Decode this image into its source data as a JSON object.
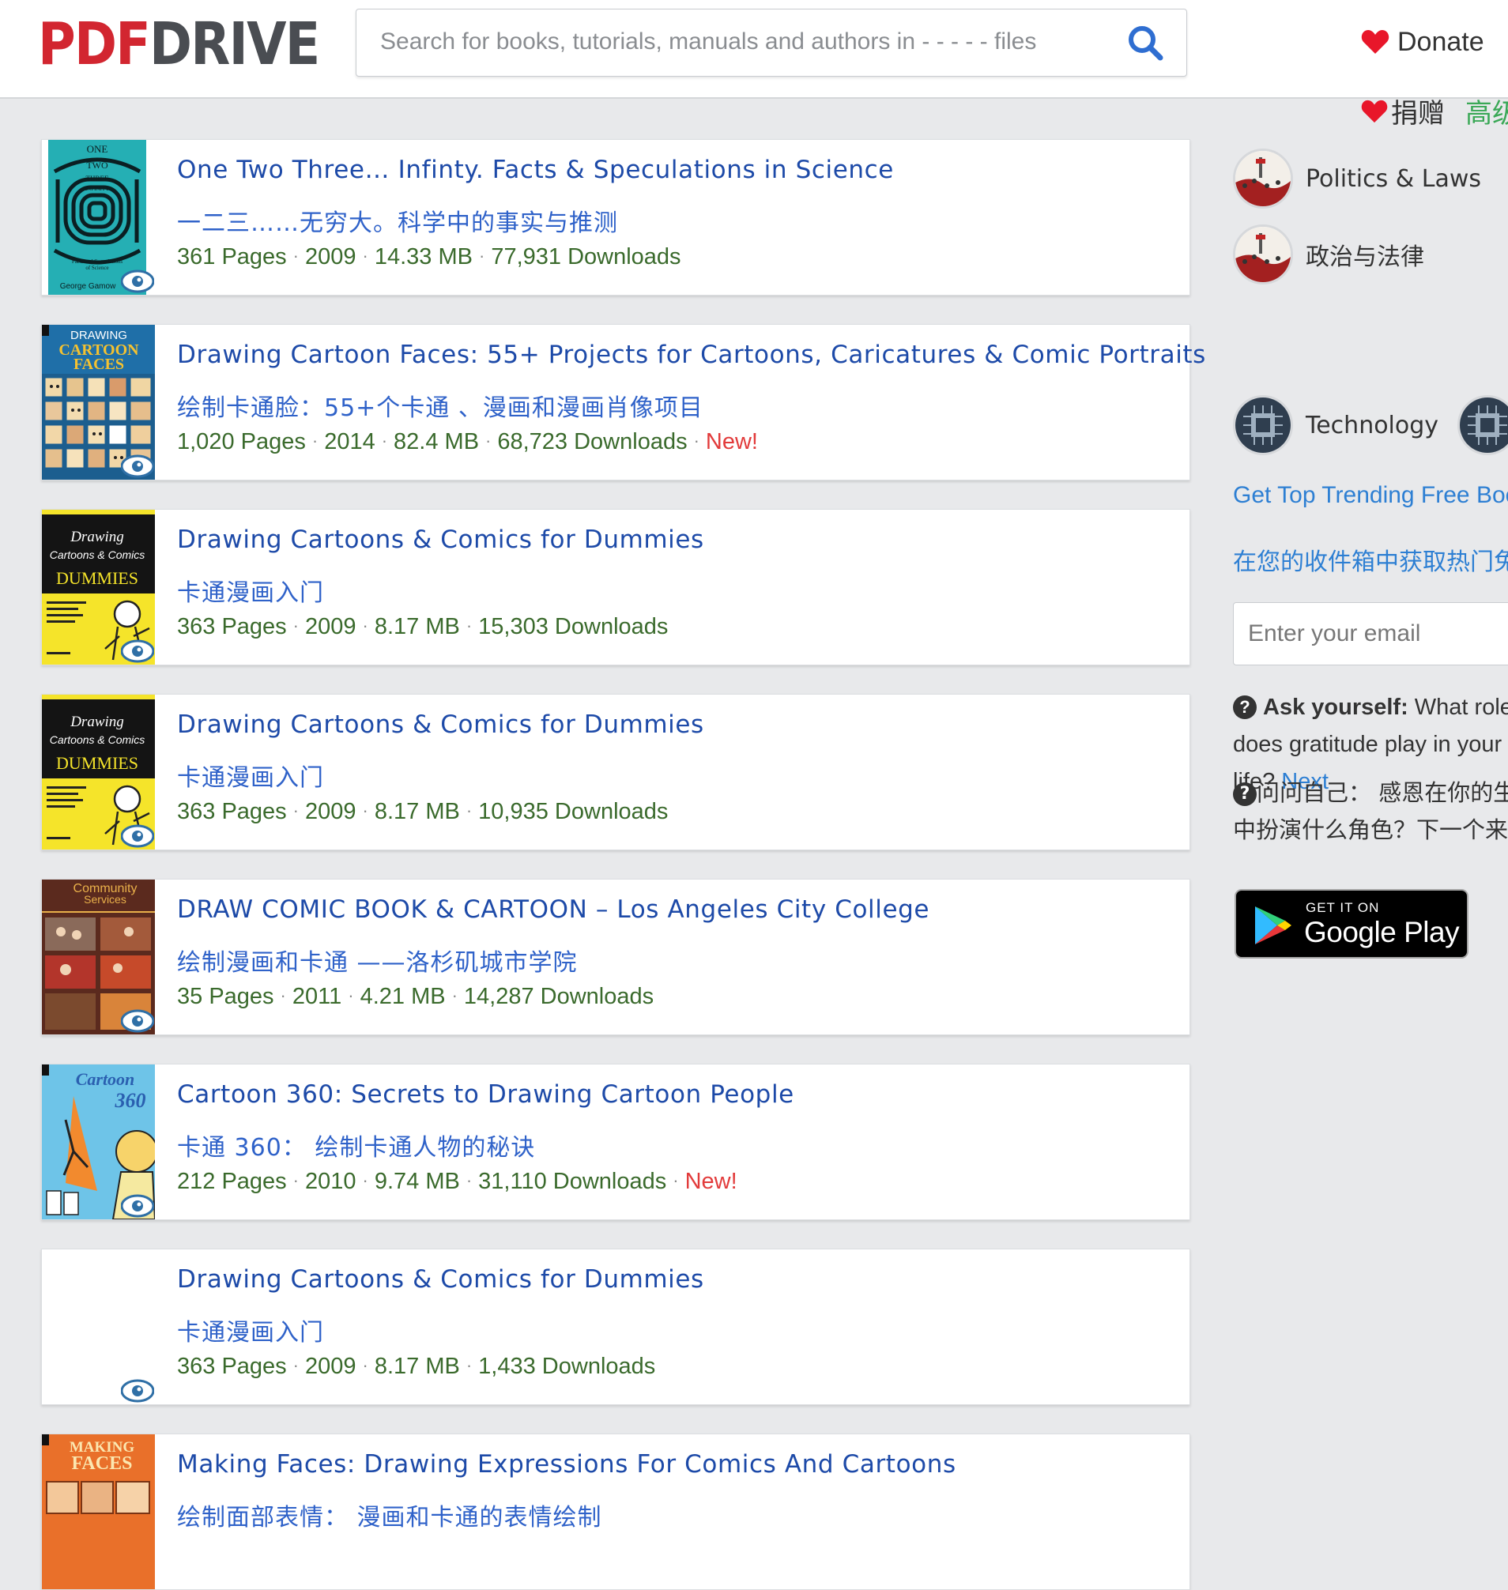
{
  "header": {
    "logo_pdf": "PDF",
    "logo_drive": "DRIVE",
    "search_placeholder": "Search for books, tutorials, manuals and authors in - - - - - files",
    "donate_label": "Donate",
    "donate_cn_label": "捐赠",
    "donate_cn_green": "高级"
  },
  "books": [
    {
      "title": "One Two Three… Infinty. Facts & Speculations in Science",
      "title_cn": "一二三……无穷大。科学中的事实与推测",
      "pages": "361 Pages",
      "year": "2009",
      "size": "14.33 MB",
      "downloads": "77,931 Downloads",
      "new": ""
    },
    {
      "title": "Drawing Cartoon Faces: 55+ Projects for Cartoons, Caricatures & Comic Portraits",
      "title_cn": "绘制卡通脸：55+个卡通 、漫画和漫画肖像项目",
      "pages": "1,020 Pages",
      "year": "2014",
      "size": "82.4 MB",
      "downloads": "68,723 Downloads",
      "new": "New!"
    },
    {
      "title": "Drawing Cartoons & Comics for Dummies",
      "title_cn": "卡通漫画入门",
      "pages": "363 Pages",
      "year": "2009",
      "size": "8.17 MB",
      "downloads": "15,303 Downloads",
      "new": ""
    },
    {
      "title": "Drawing Cartoons & Comics for Dummies",
      "title_cn": "卡通漫画入门",
      "pages": "363 Pages",
      "year": "2009",
      "size": "8.17 MB",
      "downloads": "10,935 Downloads",
      "new": ""
    },
    {
      "title": "DRAW COMIC BOOK & CARTOON – Los Angeles City College",
      "title_cn": "绘制漫画和卡通 ——洛杉矶城市学院",
      "pages": "35 Pages",
      "year": "2011",
      "size": "4.21 MB",
      "downloads": "14,287 Downloads",
      "new": ""
    },
    {
      "title": "Cartoon 360: Secrets to Drawing Cartoon People",
      "title_cn": "卡通 360：  绘制卡通人物的秘诀",
      "pages": "212 Pages",
      "year": "2010",
      "size": "9.74 MB",
      "downloads": "31,110 Downloads",
      "new": "New!"
    },
    {
      "title": "Drawing Cartoons & Comics for Dummies",
      "title_cn": "卡通漫画入门",
      "pages": "363 Pages",
      "year": "2009",
      "size": "8.17 MB",
      "downloads": "1,433 Downloads",
      "new": ""
    },
    {
      "title": "Making Faces: Drawing Expressions For Comics And Cartoons",
      "title_cn": "绘制面部表情：  漫画和卡通的表情绘制",
      "pages": "",
      "year": "",
      "size": "",
      "downloads": "",
      "new": ""
    }
  ],
  "covers": {
    "one_two_three": [
      "ONE",
      "TWO",
      "THREE",
      "INFINITY",
      "Facts and Speculations",
      "of Science",
      "George Gamow"
    ],
    "drawing_cartoon_faces": [
      "DRAWING",
      "CARTOON",
      "FACES"
    ],
    "dummies": [
      "Drawing",
      "Cartoons & Comics",
      "DUMMIES"
    ],
    "community": [
      "Community",
      "Services"
    ],
    "cartoon360": [
      "Cartoon",
      "360"
    ],
    "making_faces": [
      "MAKING",
      "FACES"
    ]
  },
  "sidebar": {
    "categories": [
      {
        "label": "Politics & Laws"
      },
      {
        "label": "政治与法律"
      },
      {
        "label": "Technology"
      }
    ],
    "trending_en": "Get Top Trending Free Books",
    "trending_cn": "在您的收件箱中获取热门免",
    "email_placeholder": "Enter your email",
    "ask_bold": "Ask yourself:",
    "ask_text": " What role does gratitude play in your life?",
    "ask_next": "Next",
    "ask_cn_bold": "问问自己：",
    "ask_cn_text": "  感恩在你的生活中扮演什么角色？下一个来",
    "gplay_small": "GET IT ON",
    "gplay_big": "Google Play"
  },
  "colors": {
    "logo_red": "#d22630",
    "logo_gray": "#4a4d52",
    "title_blue": "#1d4aa8",
    "meta_green": "#3a6a2c",
    "new_red": "#e23b3b",
    "link_blue": "#2d7fd3",
    "page_bg": "#e8e9eb"
  }
}
